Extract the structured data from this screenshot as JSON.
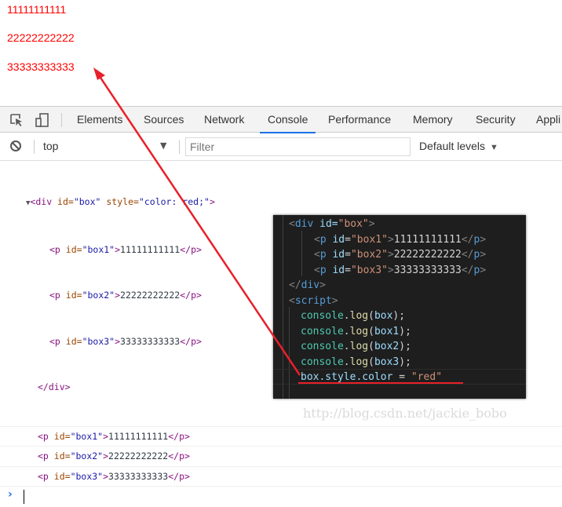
{
  "page": {
    "lines": [
      "11111111111",
      "22222222222",
      "33333333333"
    ],
    "text_color": "#ff0000"
  },
  "devtools": {
    "tabs": [
      {
        "label": "Elements"
      },
      {
        "label": "Sources"
      },
      {
        "label": "Network"
      },
      {
        "label": "Console",
        "active": true
      },
      {
        "label": "Performance"
      },
      {
        "label": "Memory"
      },
      {
        "label": "Security"
      },
      {
        "label": "Appli"
      }
    ],
    "toolbar": {
      "context": "top",
      "filter_placeholder": "Filter",
      "levels": "Default levels"
    },
    "console": {
      "div_open": {
        "tag": "<div",
        "id_attr": " id=",
        "id_val": "\"box\"",
        "style_attr": " style=",
        "style_val": "\"color: red;\"",
        "close": ">"
      },
      "children": [
        {
          "id": "\"box1\"",
          "text": "11111111111"
        },
        {
          "id": "\"box2\"",
          "text": "22222222222"
        },
        {
          "id": "\"box3\"",
          "text": "33333333333"
        }
      ],
      "div_close": "</div>",
      "logs": [
        {
          "id": "\"box1\"",
          "text": "11111111111"
        },
        {
          "id": "\"box2\"",
          "text": "22222222222"
        },
        {
          "id": "\"box3\"",
          "text": "33333333333"
        }
      ],
      "p_open": "<p",
      "id_attr": " id=",
      "gt": ">",
      "p_close": "</p>"
    }
  },
  "editor": {
    "div_line": {
      "lt": "<",
      "name": "div",
      "attr": " id=",
      "val": "\"box\"",
      "gt": ">"
    },
    "p_lines": [
      {
        "id": "\"box1\"",
        "text": "11111111111"
      },
      {
        "id": "\"box2\"",
        "text": "22222222222"
      },
      {
        "id": "\"box3\"",
        "text": "33333333333"
      }
    ],
    "div_close": {
      "lt": "</",
      "name": "div",
      "gt": ">"
    },
    "script_open": {
      "lt": "<",
      "name": "script",
      "gt": ">"
    },
    "logs": [
      {
        "obj": "console",
        "fn": "log",
        "arg": "box"
      },
      {
        "obj": "console",
        "fn": "log",
        "arg": "box1"
      },
      {
        "obj": "console",
        "fn": "log",
        "arg": "box2"
      },
      {
        "obj": "console",
        "fn": "log",
        "arg": "box3"
      }
    ],
    "assign": {
      "lhs": "box.style.color",
      "op": " = ",
      "rhs": "\"red\""
    }
  },
  "annotation": {
    "color": "#e8202a"
  },
  "watermark": "http://blog.csdn.net/jackie_bobo"
}
